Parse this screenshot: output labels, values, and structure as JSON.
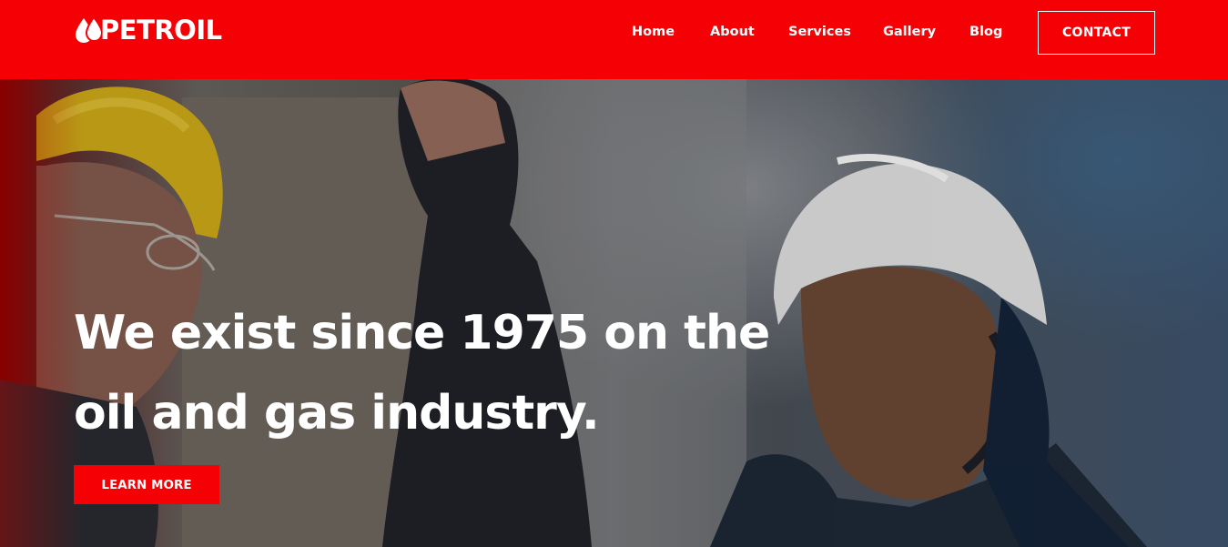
{
  "brand": {
    "name": "PETROIL",
    "logo_icon": "oil-drop-icon",
    "primary_color": "#f50004"
  },
  "nav": {
    "items": [
      {
        "label": "Home"
      },
      {
        "label": "About"
      },
      {
        "label": "Services"
      },
      {
        "label": "Gallery"
      },
      {
        "label": "Blog"
      }
    ],
    "contact_label": "CONTACT"
  },
  "hero": {
    "headline_line1": "We exist since 1975 on the",
    "headline_line2": "oil and gas industry.",
    "cta_label": "LEARN MORE",
    "image": "oil-workers-in-hard-hats-photo"
  }
}
